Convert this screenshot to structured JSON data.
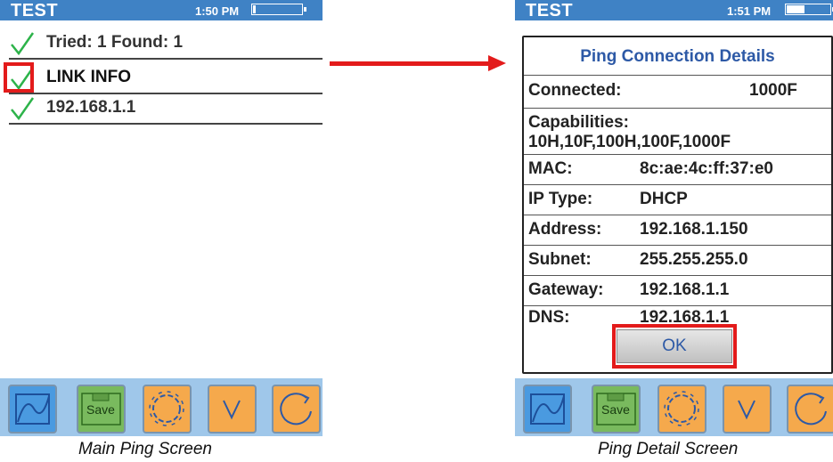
{
  "main_screen": {
    "title": "TEST",
    "time": "1:50 PM",
    "battery_level": 0.05,
    "rows": [
      {
        "label": "Tried: 1 Found: 1"
      },
      {
        "label": "LINK INFO"
      },
      {
        "label": "192.168.1.1"
      }
    ],
    "caption": "Main Ping Screen"
  },
  "detail_screen": {
    "title": "TEST",
    "time": "1:51 PM",
    "battery_level": 0.4,
    "dialog": {
      "title": "Ping Connection Details",
      "connected_label": "Connected:",
      "connected_value": "1000F",
      "capabilities_label": "Capabilities:",
      "capabilities_value": "10H,10F,100H,100F,1000F",
      "mac_label": "MAC:",
      "mac_value": "8c:ae:4c:ff:37:e0",
      "ip_type_label": "IP Type:",
      "ip_type_value": "DHCP",
      "address_label": "Address:",
      "address_value": "192.168.1.150",
      "subnet_label": "Subnet:",
      "subnet_value": "255.255.255.0",
      "gateway_label": "Gateway:",
      "gateway_value": "192.168.1.1",
      "dns_label": "DNS:",
      "dns_value": "192.168.1.1",
      "ok_label": "OK"
    },
    "caption": "Ping Detail Screen"
  },
  "toolbar": {
    "save_label": "Save",
    "buttons": [
      "graph-icon",
      "save-icon",
      "gear-icon",
      "chevron-down-icon",
      "refresh-icon"
    ]
  },
  "colors": {
    "titlebar": "#3f82c5",
    "highlight": "#e31b1b",
    "check": "#2db34a",
    "dialog_title": "#2d59a6"
  }
}
